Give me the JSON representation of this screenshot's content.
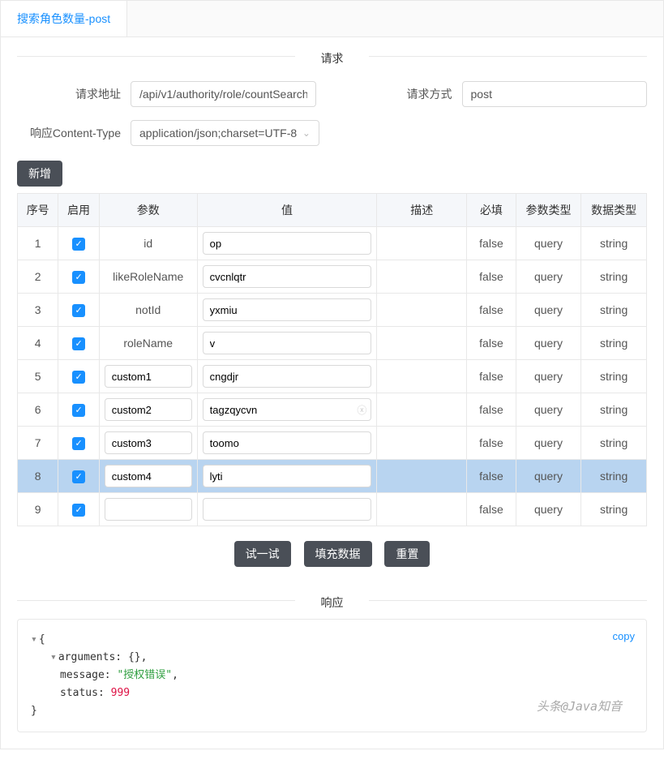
{
  "tab": {
    "label": "搜索角色数量-post"
  },
  "request": {
    "section_title": "请求",
    "url_label": "请求地址",
    "url_value": "/api/v1/authority/role/countSearch",
    "method_label": "请求方式",
    "method_value": "post",
    "content_type_label": "响应Content-Type",
    "content_type_value": "application/json;charset=UTF-8"
  },
  "add_button": "新增",
  "columns": {
    "seq": "序号",
    "enable": "启用",
    "param": "参数",
    "value": "值",
    "desc": "描述",
    "required": "必填",
    "param_type": "参数类型",
    "data_type": "数据类型"
  },
  "rows": [
    {
      "seq": "1",
      "enabled": true,
      "param": "id",
      "param_editable": false,
      "value": "op",
      "desc": "",
      "required": "false",
      "param_type": "query",
      "data_type": "string"
    },
    {
      "seq": "2",
      "enabled": true,
      "param": "likeRoleName",
      "param_editable": false,
      "value": "cvcnlqtr",
      "desc": "",
      "required": "false",
      "param_type": "query",
      "data_type": "string"
    },
    {
      "seq": "3",
      "enabled": true,
      "param": "notId",
      "param_editable": false,
      "value": "yxmiu",
      "desc": "",
      "required": "false",
      "param_type": "query",
      "data_type": "string"
    },
    {
      "seq": "4",
      "enabled": true,
      "param": "roleName",
      "param_editable": false,
      "value": "v",
      "desc": "",
      "required": "false",
      "param_type": "query",
      "data_type": "string"
    },
    {
      "seq": "5",
      "enabled": true,
      "param": "custom1",
      "param_editable": true,
      "value": "cngdjr",
      "desc": "",
      "required": "false",
      "param_type": "query",
      "data_type": "string"
    },
    {
      "seq": "6",
      "enabled": true,
      "param": "custom2",
      "param_editable": true,
      "value": "tagzqycvn",
      "has_clear": true,
      "desc": "",
      "required": "false",
      "param_type": "query",
      "data_type": "string"
    },
    {
      "seq": "7",
      "enabled": true,
      "param": "custom3",
      "param_editable": true,
      "value": "toomo",
      "desc": "",
      "required": "false",
      "param_type": "query",
      "data_type": "string"
    },
    {
      "seq": "8",
      "enabled": true,
      "param": "custom4",
      "param_editable": true,
      "value": "lyti",
      "desc": "",
      "required": "false",
      "param_type": "query",
      "data_type": "string",
      "selected": true
    },
    {
      "seq": "9",
      "enabled": true,
      "param": "",
      "param_editable": true,
      "value": "",
      "desc": "",
      "required": "false",
      "param_type": "query",
      "data_type": "string"
    }
  ],
  "actions": {
    "try": "试一试",
    "fill": "填充数据",
    "reset": "重置"
  },
  "response": {
    "section_title": "响应",
    "copy_label": "copy",
    "json": {
      "arguments_key": "arguments",
      "arguments_val": "{}",
      "message_key": "message",
      "message_val": "\"授权错误\"",
      "status_key": "status",
      "status_val": "999"
    }
  },
  "watermark": "头条@Java知音"
}
